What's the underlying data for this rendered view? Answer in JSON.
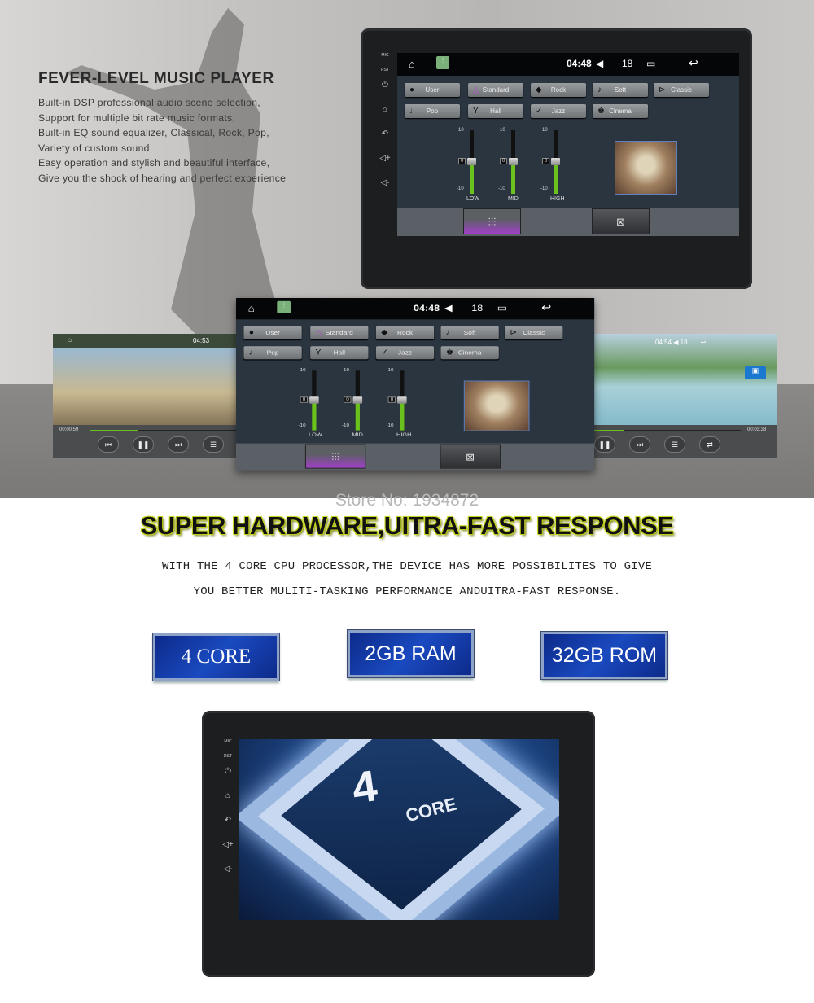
{
  "intro": {
    "title": "FEVER-LEVEL MUSIC PLAYER",
    "lines": [
      "Built-in DSP professional audio scene selection,",
      "Support for multiple bit rate music formats,",
      "Built-in EQ sound equalizer, Classical, Rock, Pop,",
      "Variety of custom sound,",
      "Easy operation and stylish and beautiful interface,",
      "Give you the shock of hearing and perfect experience"
    ]
  },
  "side_buttons": {
    "mic": "MIC",
    "rst": "RST",
    "icons": [
      "power-icon",
      "home-icon",
      "back-icon",
      "volume-up-icon",
      "volume-down-icon"
    ]
  },
  "eq_screen": {
    "time": "04:48",
    "volume": "18",
    "presets": [
      {
        "label": "User",
        "icon": "user-icon",
        "glyph": "●"
      },
      {
        "label": "Standard",
        "icon": "triangle-icon",
        "glyph": "△",
        "selected": true
      },
      {
        "label": "Rock",
        "icon": "rock-icon",
        "glyph": "◆"
      },
      {
        "label": "Soft",
        "icon": "note-icon",
        "glyph": "♪"
      },
      {
        "label": "Classic",
        "icon": "harp-icon",
        "glyph": "⊳"
      },
      {
        "label": "Pop",
        "icon": "guitar-icon",
        "glyph": "♩"
      },
      {
        "label": "Hall",
        "icon": "glass-icon",
        "glyph": "Y"
      },
      {
        "label": "Jazz",
        "icon": "check-icon",
        "glyph": "✓"
      },
      {
        "label": "Cinema",
        "icon": "crown-icon",
        "glyph": "♚"
      }
    ],
    "bands": [
      {
        "label": "LOW",
        "max": "10",
        "min": "-10",
        "value": "0"
      },
      {
        "label": "MID",
        "max": "10",
        "min": "-10",
        "value": "0"
      },
      {
        "label": "HIGH",
        "max": "10",
        "min": "-10",
        "value": "0"
      }
    ],
    "bottom_buttons": [
      {
        "icon": "equalizer-icon",
        "glyph": "⫶⫶⫶",
        "active": true
      },
      {
        "icon": "surround-icon",
        "glyph": "⊠"
      }
    ]
  },
  "left_video": {
    "time": "04:53",
    "elapsed": "00:00:59",
    "progress": 0.32
  },
  "right_video": {
    "time": "04:54",
    "volume": "18",
    "total": "00:03:38",
    "progress": 0.2
  },
  "store": "Store No: 1934872",
  "hardware": {
    "title": "SUPER HARDWARE,UITRA-FAST RESPONSE",
    "lines": [
      "WITH THE 4 CORE CPU PROCESSOR,THE DEVICE HAS MORE POSSIBILITES TO GIVE",
      "YOU BETTER MULITI-TASKING PERFORMANCE ANDUITRA-FAST RESPONSE."
    ],
    "badges": [
      "4 CORE",
      "2GB RAM",
      "32GB ROM"
    ]
  },
  "chip": {
    "number": "4",
    "label": "CORE"
  }
}
